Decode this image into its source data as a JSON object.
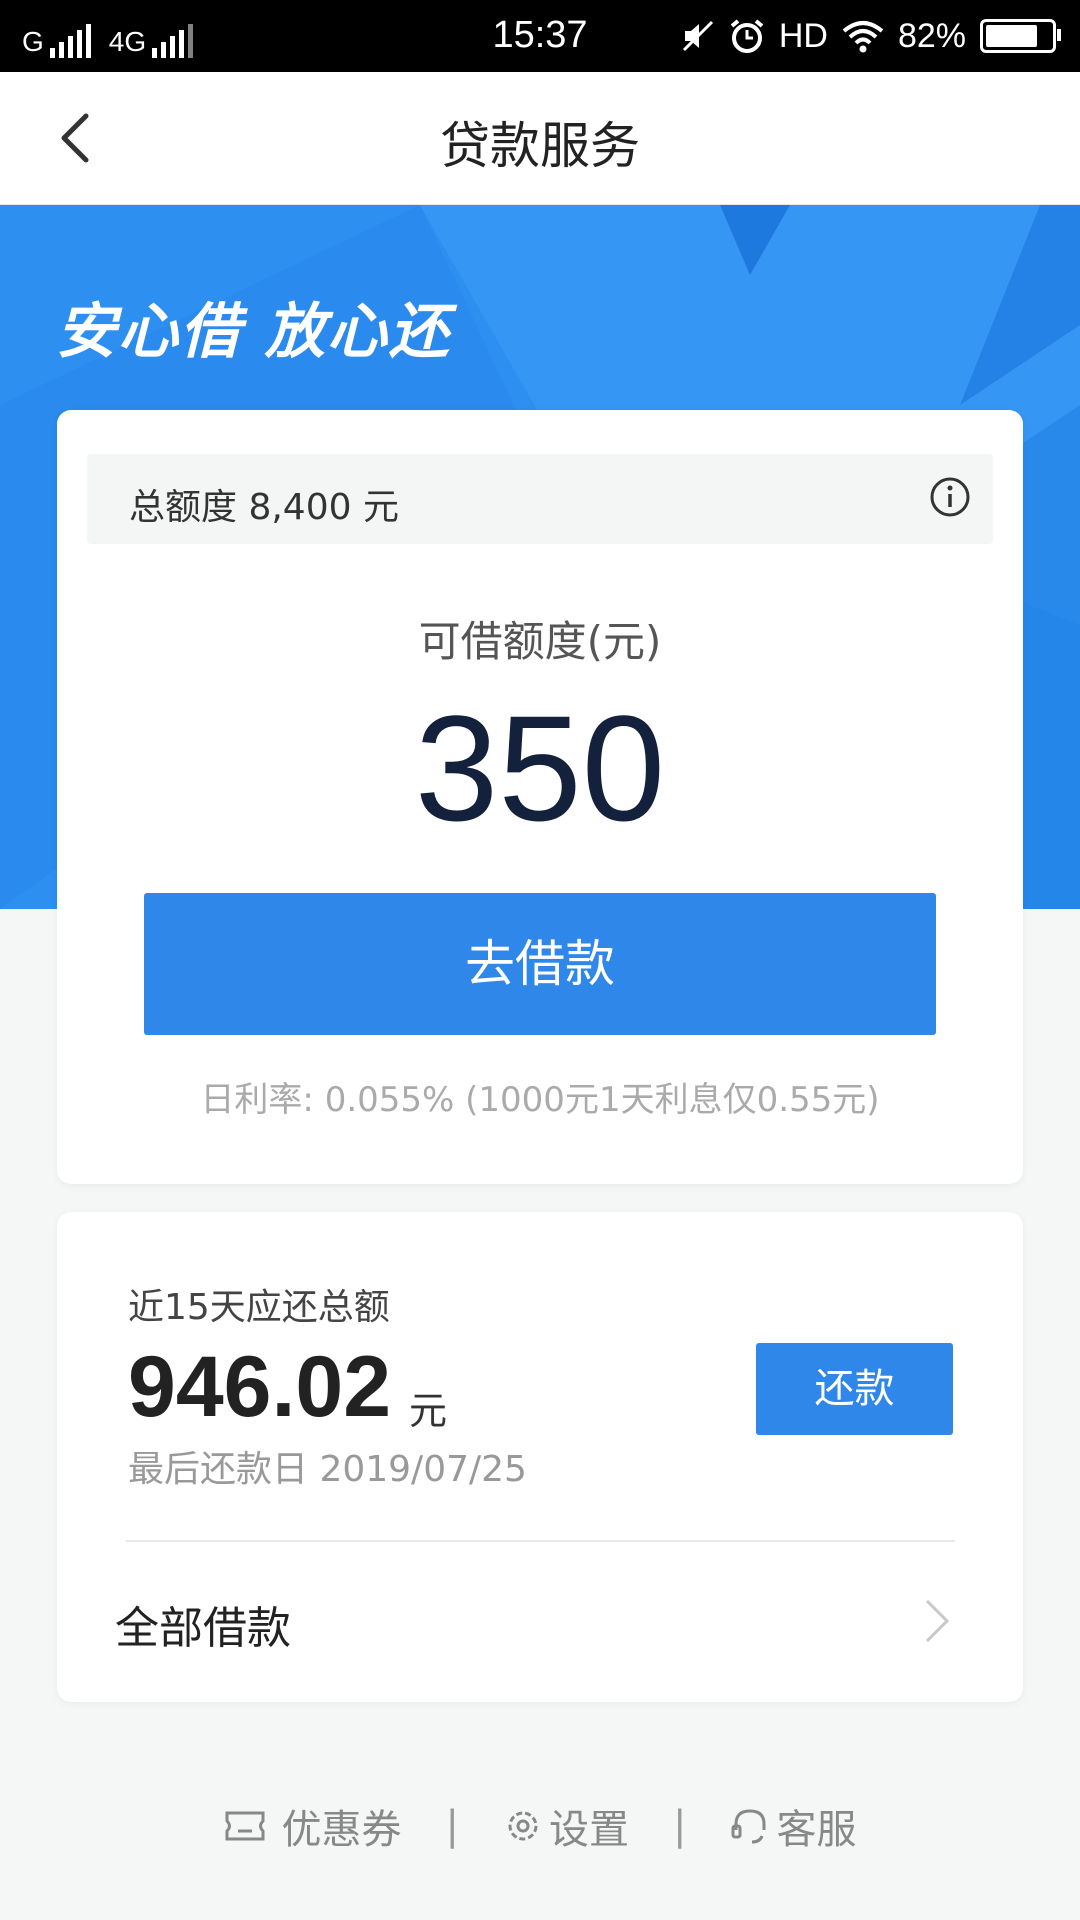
{
  "status_bar": {
    "carrier_1": "G",
    "carrier_2": "4G",
    "time": "15:37",
    "hd": "HD",
    "battery": "82%",
    "battery_level": 0.82
  },
  "nav": {
    "title": "贷款服务",
    "back_icon": "chevron-left-icon"
  },
  "hero": {
    "slogan": "安心借 放心还"
  },
  "credit_card": {
    "total_quota": "总额度 8,400 元",
    "info_icon": "info-icon",
    "available_label": "可借额度(元)",
    "available_value": "350",
    "borrow_button": "去借款",
    "rate_text": "日利率: 0.055% (1000元1天利息仅0.55元)"
  },
  "repay_card": {
    "due_label": "近15天应还总额",
    "due_amount": "946.02",
    "due_unit": "元",
    "due_date": "最后还款日 2019/07/25",
    "repay_button": "还款",
    "all_loans": "全部借款",
    "chevron_icon": "chevron-right-icon"
  },
  "footer": {
    "coupon": "优惠券",
    "settings": "设置",
    "service": "客服",
    "separator": "|"
  },
  "colors": {
    "primary": "#2e87e9",
    "hero_bg": "#2d8ff0",
    "page_bg": "#f4f7f6"
  }
}
